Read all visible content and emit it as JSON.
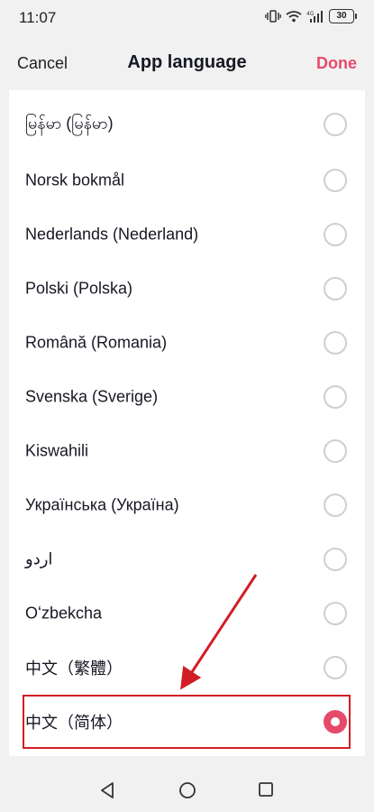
{
  "status_bar": {
    "time": "11:07",
    "battery": "30",
    "icons": [
      "vibrate-icon",
      "wifi-icon",
      "4g-signal-icon",
      "battery-icon"
    ]
  },
  "header": {
    "cancel_label": "Cancel",
    "title": "App language",
    "done_label": "Done"
  },
  "languages": [
    {
      "label": "မြန်မာ (မြန်မာ)",
      "selected": false
    },
    {
      "label": "Norsk bokmål",
      "selected": false
    },
    {
      "label": "Nederlands (Nederland)",
      "selected": false
    },
    {
      "label": "Polski (Polska)",
      "selected": false
    },
    {
      "label": "Română (Romania)",
      "selected": false
    },
    {
      "label": "Svenska (Sverige)",
      "selected": false
    },
    {
      "label": "Kiswahili",
      "selected": false
    },
    {
      "label": "Українська (Україна)",
      "selected": false
    },
    {
      "label": "اردو",
      "selected": false
    },
    {
      "label": "Oʻzbekcha",
      "selected": false
    },
    {
      "label": "中文（繁體）",
      "selected": false
    },
    {
      "label": "中文（简体）",
      "selected": true
    }
  ],
  "colors": {
    "accent": "#e64a6a",
    "annotation": "#d11e24",
    "background": "#f1f1f2",
    "card": "#ffffff"
  },
  "nav_bar": {
    "icons": [
      "back-triangle-icon",
      "home-circle-icon",
      "recents-square-icon"
    ]
  }
}
